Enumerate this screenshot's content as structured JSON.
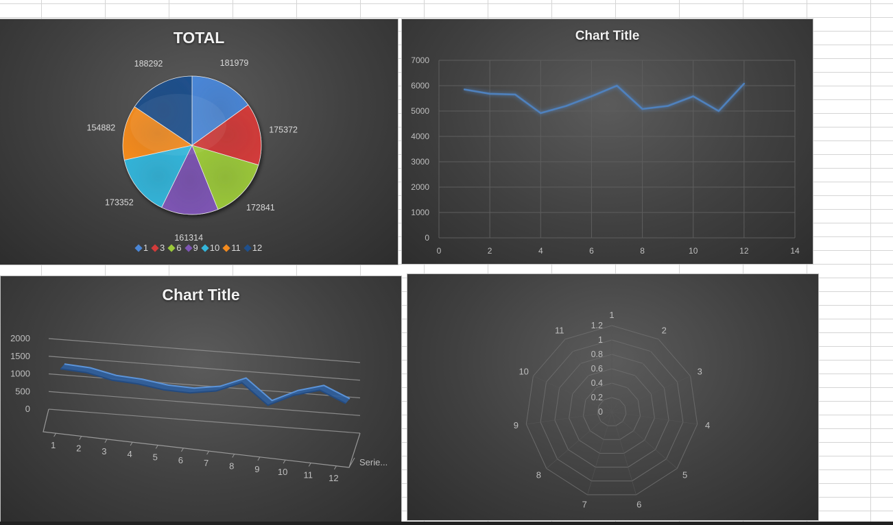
{
  "top_cut_labels": [
    "",
    ""
  ],
  "colors": {
    "series_line": "#4f81bd",
    "pie": [
      "#4a86d6",
      "#d23b3a",
      "#9bc83a",
      "#7d55b3",
      "#33b5da",
      "#f28a1e",
      "#1f4f8b"
    ]
  },
  "chart_data": [
    {
      "type": "pie",
      "title": "TOTAL",
      "categories": [
        "1",
        "3",
        "6",
        "9",
        "10",
        "11",
        "12"
      ],
      "values": [
        181979,
        175372,
        172841,
        161314,
        173352,
        154882,
        188292
      ],
      "legend": "bottom"
    },
    {
      "type": "line",
      "title": "Chart Title",
      "x": [
        1,
        2,
        3,
        4,
        5,
        6,
        7,
        8,
        9,
        10,
        11,
        12
      ],
      "y": [
        5850,
        5680,
        5650,
        4920,
        5200,
        5580,
        6000,
        5080,
        5200,
        5580,
        5000,
        6080
      ],
      "xlim": [
        0,
        14
      ],
      "xticks": [
        0,
        2,
        4,
        6,
        8,
        10,
        12,
        14
      ],
      "ylim": [
        0,
        7000
      ],
      "yticks": [
        0,
        1000,
        2000,
        3000,
        4000,
        5000,
        6000,
        7000
      ],
      "grid": true
    },
    {
      "type": "line",
      "title": "Chart Title",
      "subtype": "3d-line",
      "categories": [
        "1",
        "2",
        "3",
        "4",
        "5",
        "6",
        "7",
        "8",
        "9",
        "10",
        "11",
        "12"
      ],
      "values": [
        1230,
        1180,
        1020,
        970,
        860,
        830,
        940,
        1230,
        650,
        990,
        1190,
        870
      ],
      "ylim": [
        0,
        2000
      ],
      "yticks": [
        0,
        500,
        1000,
        1500,
        2000
      ],
      "depth_label": "Serie..."
    },
    {
      "type": "radar",
      "title": "",
      "categories": [
        "1",
        "2",
        "3",
        "4",
        "5",
        "6",
        "7",
        "8",
        "9",
        "10",
        "11"
      ],
      "rticks": [
        "0",
        "0.2",
        "0.4",
        "0.6",
        "0.8",
        "1",
        "1.2"
      ],
      "values": []
    }
  ]
}
